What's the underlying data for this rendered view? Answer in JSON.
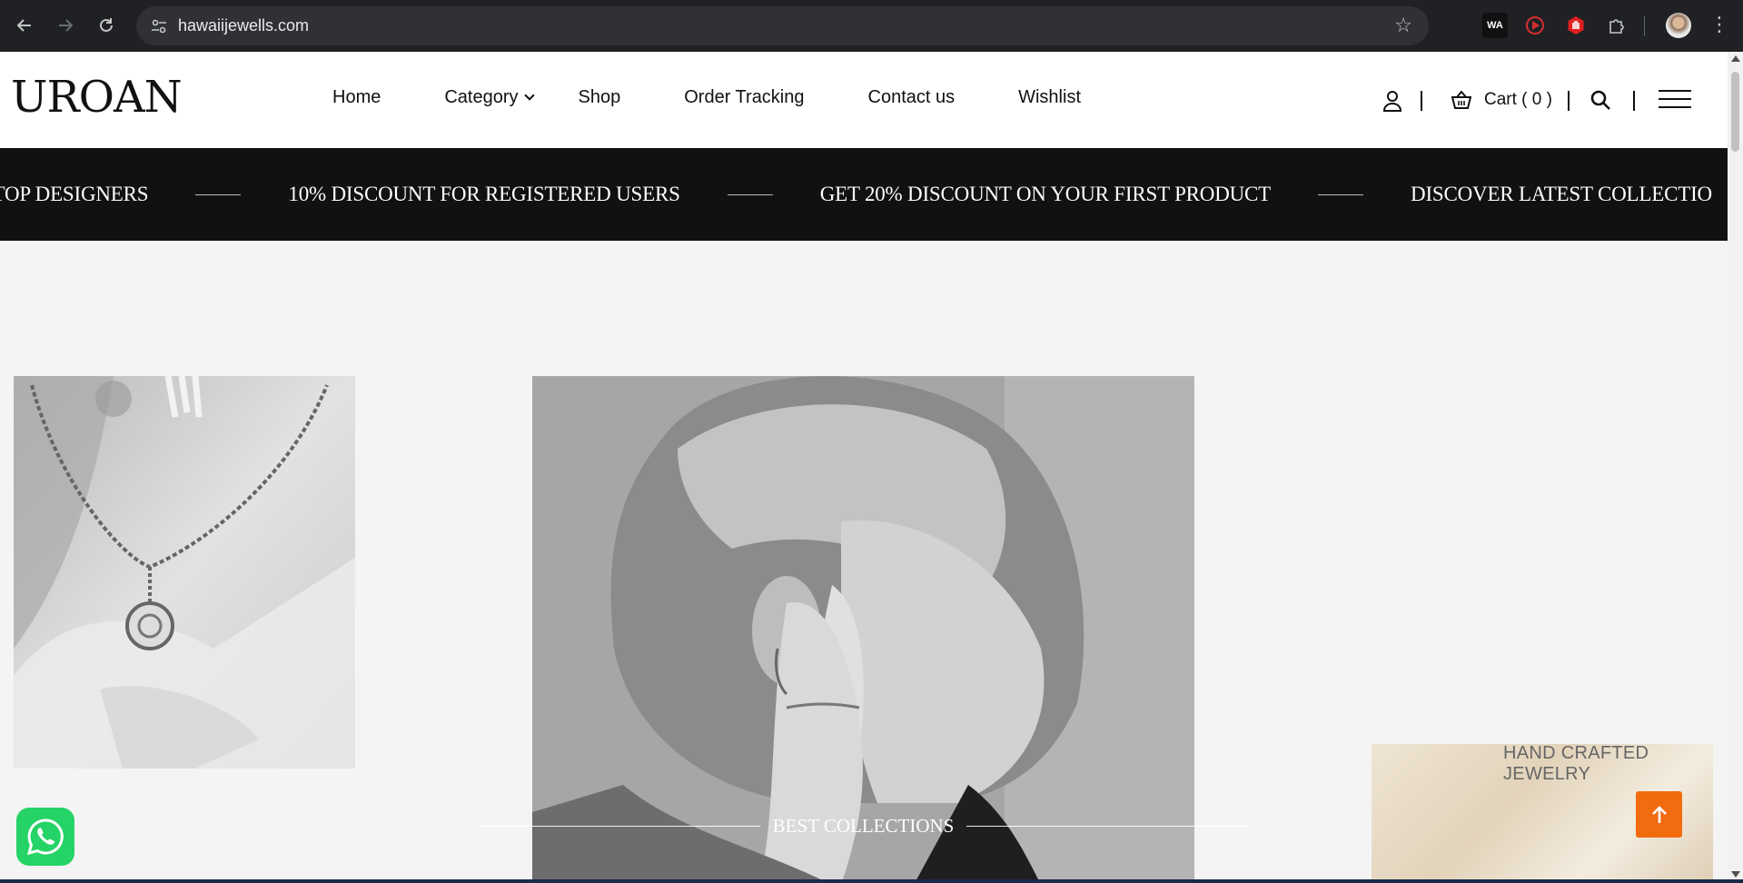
{
  "browser": {
    "url": "hawaiijewells.com",
    "extensions": [
      "whatsapp-web-extension",
      "screen-recorder-extension",
      "adblock-hand-extension",
      "extensions-puzzle"
    ],
    "ext_wa_label": "WA"
  },
  "header": {
    "logo": "UROAN",
    "nav": {
      "home": "Home",
      "category": "Category",
      "shop": "Shop",
      "order_tracking": "Order Tracking",
      "contact": "Contact us",
      "wishlist": "Wishlist"
    },
    "cart_label": "Cart ( 0 )"
  },
  "marquee": {
    "items": [
      "D TOP DESIGNERS",
      "10% DISCOUNT FOR REGISTERED USERS",
      "GET 20% DISCOUNT ON YOUR FIRST PRODUCT",
      "DISCOVER LATEST COLLECTIO"
    ]
  },
  "hero": {
    "side_label": "HAND CRAFTED JEWELRY",
    "best_collections": "BEST COLLECTIONS"
  },
  "colors": {
    "accent_orange": "#f26b0f",
    "whatsapp_green": "#25d366",
    "marquee_bg": "#111111"
  }
}
